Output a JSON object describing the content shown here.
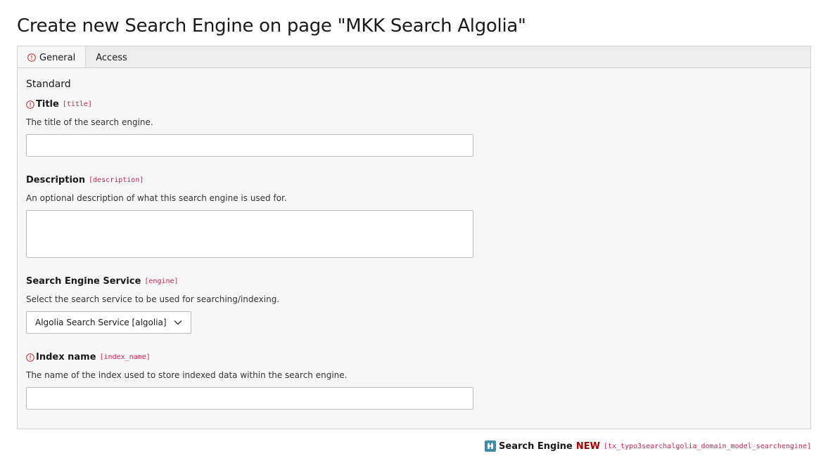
{
  "page": {
    "title": "Create new Search Engine on page \"MKK Search Algolia\""
  },
  "tabs": [
    {
      "label": "General",
      "active": true,
      "has_error": true
    },
    {
      "label": "Access",
      "active": false,
      "has_error": false
    }
  ],
  "section": {
    "heading": "Standard"
  },
  "fields": {
    "title": {
      "label": "Title",
      "field_name": "[title]",
      "description": "The title of the search engine.",
      "value": "",
      "required": true
    },
    "description": {
      "label": "Description",
      "field_name": "[description]",
      "description": "An optional description of what this search engine is used for.",
      "value": ""
    },
    "engine": {
      "label": "Search Engine Service",
      "field_name": "[engine]",
      "description": "Select the search service to be used for searching/indexing.",
      "selected": "Algolia Search Service [algolia]"
    },
    "index_name": {
      "label": "Index name",
      "field_name": "[index_name]",
      "description": "The name of the index used to store indexed data within the search engine.",
      "value": "",
      "required": true
    }
  },
  "footer": {
    "record_type": "Search Engine",
    "record_state": "NEW",
    "table_name": "[tx_typo3searchalgolia_domain_model_searchengine]"
  },
  "colors": {
    "warning": "#c83c3c",
    "field_name": "#c7254e",
    "new_badge": "#a00000",
    "record_icon": "#3c8ea8"
  },
  "icons": {
    "warning": "exclamation-circle-icon",
    "select_chevron": "chevron-down-icon",
    "record": "search-engine-record-icon"
  }
}
